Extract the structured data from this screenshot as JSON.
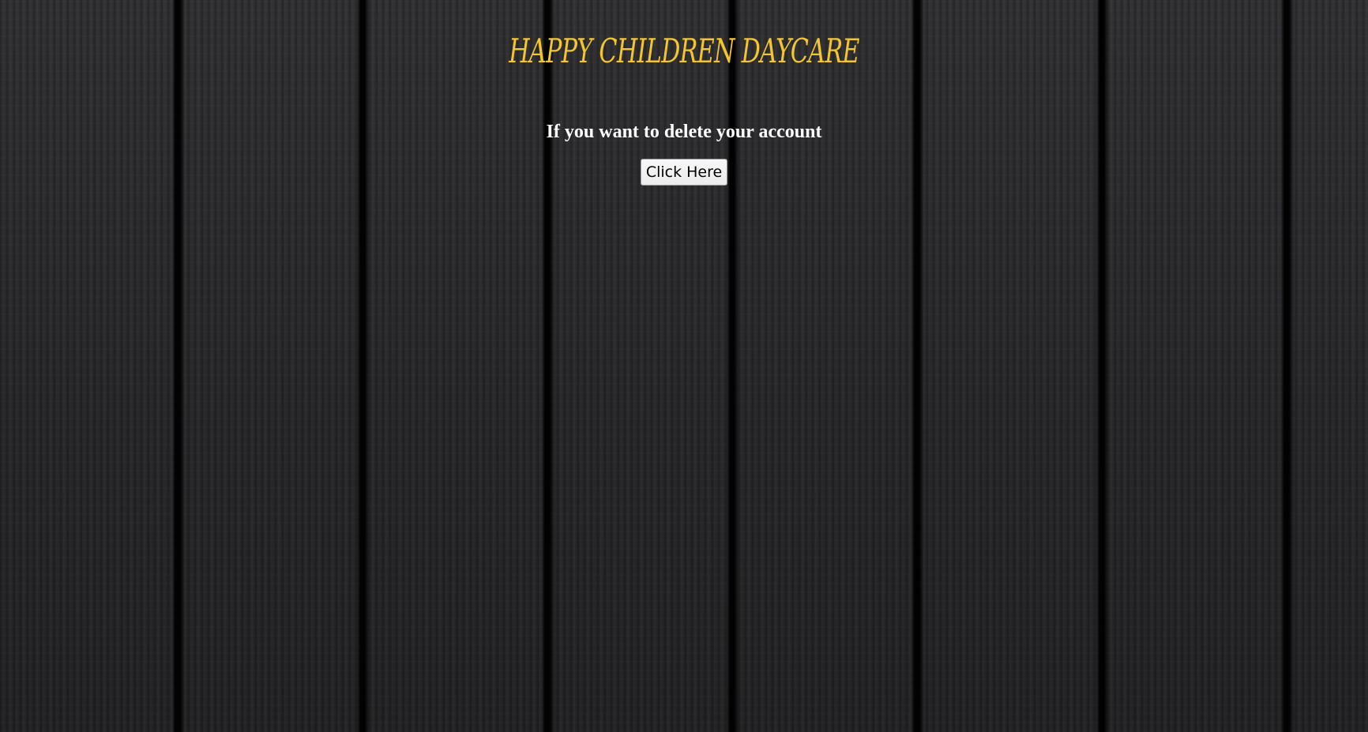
{
  "header": {
    "title": "HAPPY CHILDREN DAYCARE"
  },
  "main": {
    "prompt_text": "If you want to delete your account",
    "button_label": "Click Here"
  },
  "colors": {
    "title": "#f2c531",
    "prompt_text": "#ffffff",
    "background": "#2a2a2c",
    "button_background": "#efefef"
  }
}
